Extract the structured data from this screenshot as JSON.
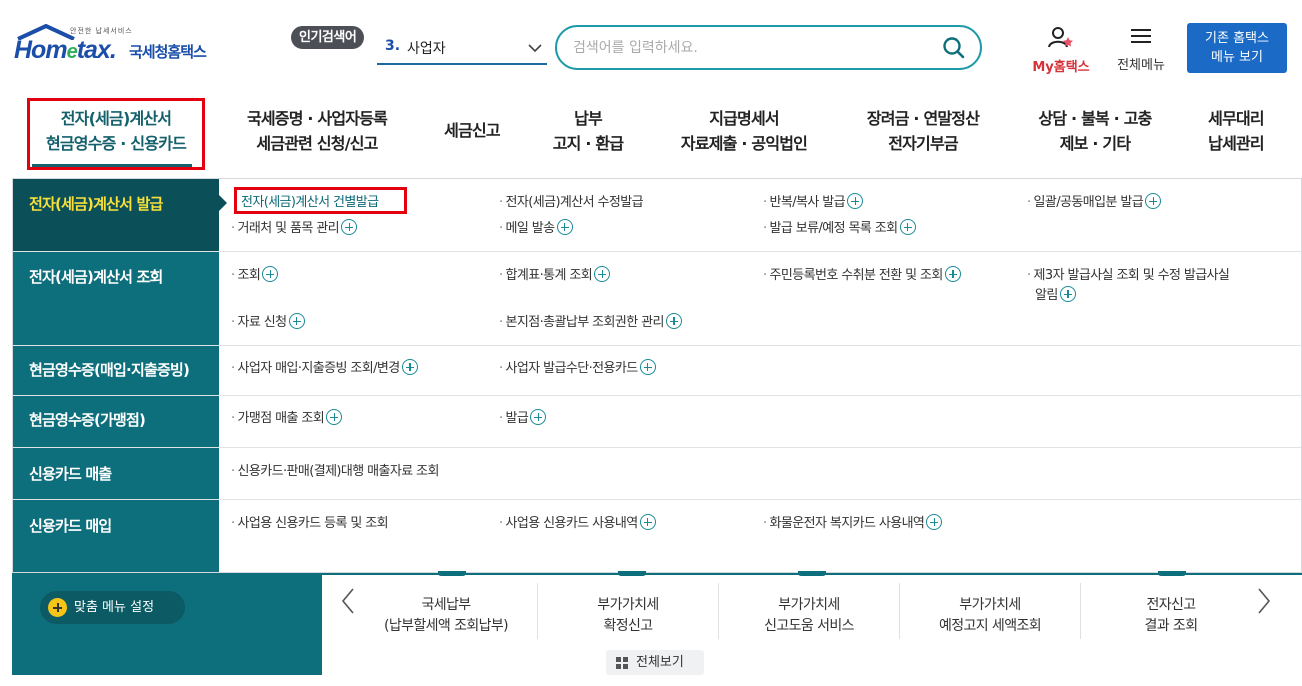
{
  "header": {
    "logo_tagline": "안전한 납세서비스",
    "logo_home": "Hom",
    "logo_e": "e",
    "logo_tax": "tax.",
    "logo_name": "국세청홈택스",
    "hot_badge": "인기검색어",
    "hot_rank": "3.",
    "hot_word": "사업자",
    "search_placeholder": "검색어를 입력하세요.",
    "my_home": "My홈택스",
    "all_menu": "전체메뉴",
    "old_menu_line1": "기존 홈택스",
    "old_menu_line2": "메뉴 보기"
  },
  "gnb": [
    {
      "l1": "전자(세금)계산서",
      "l2": "현금영수증 · 신용카드",
      "active": true
    },
    {
      "l1": "국세증명 · 사업자등록",
      "l2": "세금관련 신청/신고"
    },
    {
      "l1": "세금신고",
      "l2": ""
    },
    {
      "l1": "납부",
      "l2": "고지 · 환급"
    },
    {
      "l1": "지급명세서",
      "l2": "자료제출 · 공익법인"
    },
    {
      "l1": "장려금 · 연말정산",
      "l2": "전자기부금"
    },
    {
      "l1": "상담 · 불복 · 고충",
      "l2": "제보 · 기타"
    },
    {
      "l1": "세무대리",
      "l2": "납세관리"
    }
  ],
  "mega": [
    {
      "cat": "전자(세금)계산서 발급",
      "links": [
        "전자(세금)계산서 건별발급",
        "전자(세금)계산서 수정발급",
        "반복/복사 발급",
        "일괄/공동매입분 발급",
        "거래처 및 품목 관리",
        "메일 발송",
        "발급 보류/예정 목록 조회"
      ]
    },
    {
      "cat": "전자(세금)계산서 조회",
      "links": [
        "조회",
        "합계표·통계 조회",
        "주민등록번호 수취분 전환 및 조회",
        "제3자 발급사실 조회 및 수정 발급사실",
        "알림",
        "자료 신청",
        "본지점·총괄납부 조회권한 관리"
      ]
    },
    {
      "cat": "현금영수증(매입·지출증빙)",
      "links": [
        "사업자 매입·지출증빙 조회/변경",
        "사업자 발급수단·전용카드"
      ]
    },
    {
      "cat": "현금영수증(가맹점)",
      "links": [
        "가맹점 매출 조회",
        "발급"
      ]
    },
    {
      "cat": "신용카드 매출",
      "links": [
        "신용카드·판매(결제)대행 매출자료 조회"
      ]
    },
    {
      "cat": "신용카드 매입",
      "links": [
        "사업용 신용카드 등록 및 조회",
        "사업용 신용카드 사용내역",
        "화물운전자 복지카드 사용내역"
      ]
    }
  ],
  "bottom": {
    "custom_menu": "맞춤 메뉴 설정",
    "quick": [
      {
        "l1": "국세납부",
        "l2": "(납부할세액 조회납부)"
      },
      {
        "l1": "부가가치세",
        "l2": "확정신고"
      },
      {
        "l1": "부가가치세",
        "l2": "신고도움 서비스"
      },
      {
        "l1": "부가가치세",
        "l2": "예정고지 세액조회"
      },
      {
        "l1": "전자신고",
        "l2": "결과 조회"
      }
    ],
    "view_all": "전체보기"
  },
  "colors": {
    "brand": "#1a4ea8",
    "teal": "#0e6f7c",
    "highlight": "#e4000f",
    "active_cat_text": "#f7e03a"
  }
}
